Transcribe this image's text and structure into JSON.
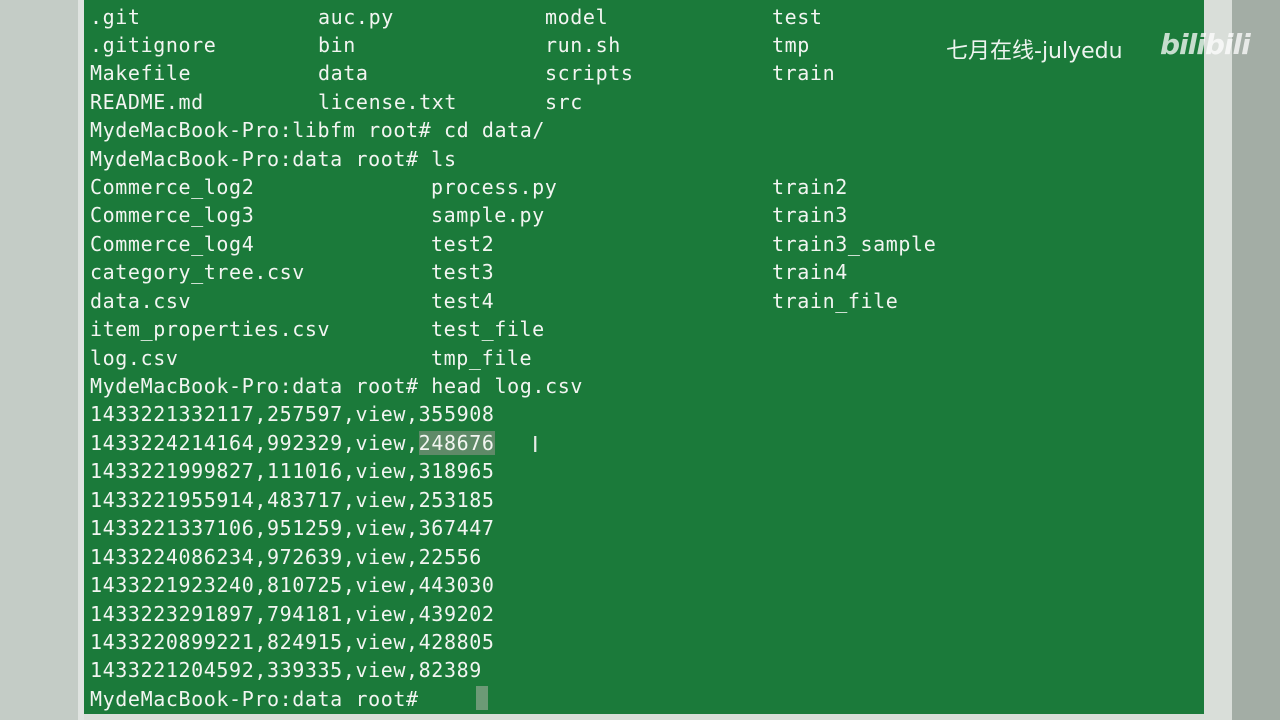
{
  "terminal": {
    "ls1": [
      [
        ".git",
        "auc.py",
        "model",
        "test"
      ],
      [
        ".gitignore",
        "bin",
        "run.sh",
        "tmp"
      ],
      [
        "Makefile",
        "data",
        "scripts",
        "train"
      ],
      [
        "README.md",
        "license.txt",
        "src",
        ""
      ]
    ],
    "cmd_cd": "MydeMacBook-Pro:libfm root# cd data/",
    "cmd_ls": "MydeMacBook-Pro:data root# ls",
    "ls2": [
      [
        "Commerce_log2",
        "process.py",
        "train2"
      ],
      [
        "Commerce_log3",
        "sample.py",
        "train3"
      ],
      [
        "Commerce_log4",
        "test2",
        "train3_sample"
      ],
      [
        "category_tree.csv",
        "test3",
        "train4"
      ],
      [
        "data.csv",
        "test4",
        "train_file"
      ],
      [
        "item_properties.csv",
        "test_file",
        ""
      ],
      [
        "log.csv",
        "tmp_file",
        ""
      ]
    ],
    "cmd_head": "MydeMacBook-Pro:data root# head log.csv",
    "csv_line_1": "1433221332117,257597,view,355908",
    "csv_line_2_prefix": "1433224214164,992329,view,",
    "csv_line_2_selected": "248676",
    "csv_line_3": "1433221999827,111016,view,318965",
    "csv_line_4": "1433221955914,483717,view,253185",
    "csv_line_5": "1433221337106,951259,view,367447",
    "csv_line_6": "1433224086234,972639,view,22556",
    "csv_line_7": "1433221923240,810725,view,443030",
    "csv_line_8": "1433223291897,794181,view,439202",
    "csv_line_9": "1433220899221,824915,view,428805",
    "csv_line_10": "1433221204592,339335,view,82389",
    "prompt": "MydeMacBook-Pro:data root# "
  },
  "watermark": {
    "text": "七月在线-julyedu",
    "logo": "bilibili"
  },
  "colors": {
    "terminal_bg": "#1b7a3a",
    "text": "#f2f5f1",
    "selection": "#5f8a68"
  }
}
